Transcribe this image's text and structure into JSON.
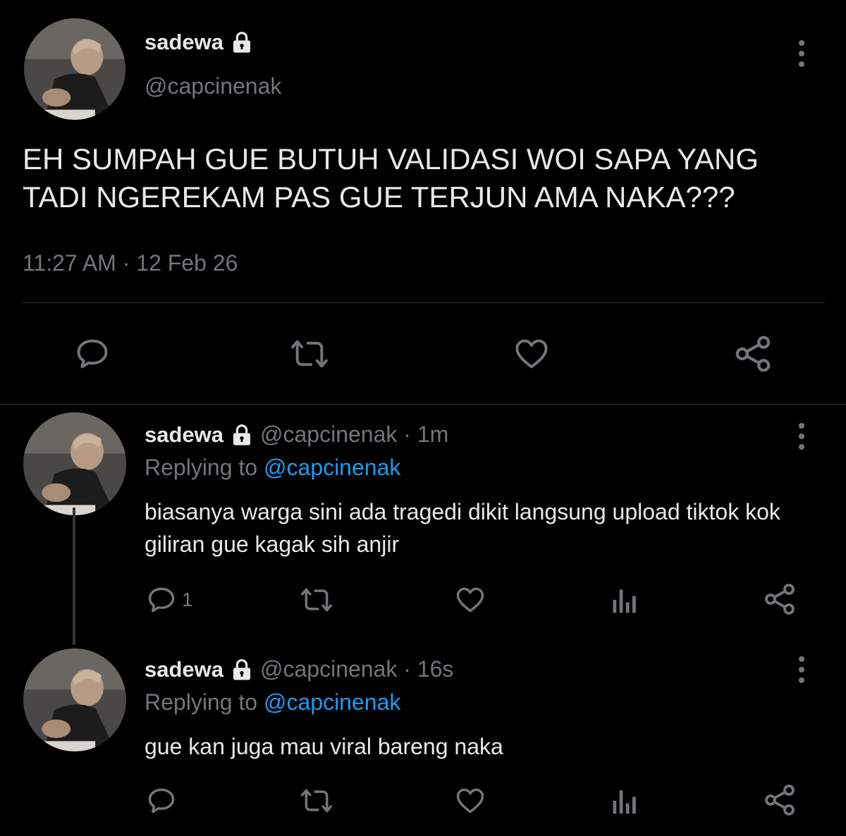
{
  "main_tweet": {
    "name": "sadewa",
    "handle": "@capcinenak",
    "text": "EH SUMPAH GUE BUTUH VALIDASI WOI SAPA YANG TADI NGEREKAM PAS GUE TERJUN AMA NAKA???",
    "timestamp": "11:27 AM · 12 Feb 26",
    "actions": [
      "reply-icon",
      "retweet-icon",
      "like-icon",
      "share-icon"
    ]
  },
  "replies": [
    {
      "name": "sadewa",
      "handle_time": "@capcinenak · 1m",
      "replying_prefix": "Replying to ",
      "replying_to": "@capcinenak",
      "text": "biasanya warga sini ada tragedi dikit langsung upload tiktok kok giliran gue kagak sih anjir",
      "reply_count": "1",
      "actions": [
        "reply-icon",
        "retweet-icon",
        "like-icon",
        "analytics-icon",
        "share-icon"
      ]
    },
    {
      "name": "sadewa",
      "handle_time": "@capcinenak · 16s",
      "replying_prefix": "Replying to ",
      "replying_to": "@capcinenak",
      "text": "gue kan juga mau viral bareng naka",
      "reply_count": "",
      "actions": [
        "reply-icon",
        "retweet-icon",
        "like-icon",
        "analytics-icon",
        "share-icon"
      ]
    }
  ],
  "colors": {
    "background": "#000000",
    "primary_text": "#e7e9ea",
    "secondary_text": "#71767b",
    "mention": "#1d9bf0",
    "divider": "#2f3336"
  }
}
